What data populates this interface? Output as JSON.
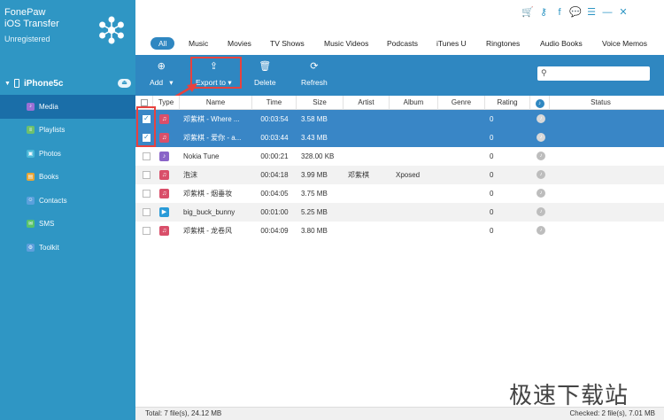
{
  "app": {
    "name_line1": "FonePaw",
    "name_line2": "iOS Transfer",
    "status": "Unregistered"
  },
  "top_icons": [
    "cart-icon",
    "key-icon",
    "facebook-icon",
    "feedback-icon",
    "menu-icon",
    "minimize-icon",
    "close-icon"
  ],
  "top_icon_glyphs": [
    "🛒",
    "⚷",
    "f",
    "💬",
    "☰",
    "—",
    "✕"
  ],
  "device": {
    "name": "iPhone5c",
    "eject_glyph": "⏏"
  },
  "sidebar": {
    "items": [
      {
        "label": "Media",
        "icon": "music-note-icon",
        "color": "#9b6fd4",
        "glyph": "♪",
        "active": true
      },
      {
        "label": "Playlists",
        "icon": "playlist-icon",
        "color": "#6dc06d",
        "glyph": "≡",
        "active": false
      },
      {
        "label": "Photos",
        "icon": "photo-icon",
        "color": "#4bb8d8",
        "glyph": "▣",
        "active": false
      },
      {
        "label": "Books",
        "icon": "book-icon",
        "color": "#e8a534",
        "glyph": "▤",
        "active": false
      },
      {
        "label": "Contacts",
        "icon": "contact-icon",
        "color": "#5aa0dc",
        "glyph": "☺",
        "active": false
      },
      {
        "label": "SMS",
        "icon": "message-icon",
        "color": "#59c36a",
        "glyph": "✉",
        "active": false
      },
      {
        "label": "Toolkit",
        "icon": "toolkit-icon",
        "color": "#5e9fdc",
        "glyph": "⚙",
        "active": false
      }
    ]
  },
  "filters": [
    "All",
    "Music",
    "Movies",
    "TV Shows",
    "Music Videos",
    "Podcasts",
    "iTunes U",
    "Ringtones",
    "Audio Books",
    "Voice Memos"
  ],
  "toolbar": {
    "add": {
      "label": "Add",
      "glyph": "⊕",
      "caret": "▾"
    },
    "export": {
      "label": "Export to",
      "glyph": "⇪",
      "caret": "▾"
    },
    "delete": {
      "label": "Delete",
      "glyph": "🗑"
    },
    "refresh": {
      "label": "Refresh",
      "glyph": "⟳"
    },
    "search_glyph": "⚲"
  },
  "table": {
    "headers": [
      "Type",
      "Name",
      "Time",
      "Size",
      "Artist",
      "Album",
      "Genre",
      "Rating",
      "Status"
    ],
    "rows": [
      {
        "checked": true,
        "selected": true,
        "type": "music",
        "type_color": "#d94f6a",
        "type_glyph": "♫",
        "name": "邓紫棋 - Where ...",
        "time": "00:03:54",
        "size": "3.58 MB",
        "artist": "",
        "album": "",
        "genre": "",
        "rating": "0"
      },
      {
        "checked": true,
        "selected": true,
        "type": "music",
        "type_color": "#d94f6a",
        "type_glyph": "♫",
        "name": "邓紫棋 - 爱你 - a...",
        "time": "00:03:44",
        "size": "3.43 MB",
        "artist": "",
        "album": "",
        "genre": "",
        "rating": "0"
      },
      {
        "checked": false,
        "selected": false,
        "type": "ringtone",
        "type_color": "#8a64c8",
        "type_glyph": "♪",
        "name": "Nokia Tune",
        "time": "00:00:21",
        "size": "328.00 KB",
        "artist": "",
        "album": "",
        "genre": "",
        "rating": "0"
      },
      {
        "checked": false,
        "selected": false,
        "type": "music",
        "type_color": "#d94f6a",
        "type_glyph": "♫",
        "name": "泡沫",
        "time": "00:04:18",
        "size": "3.99 MB",
        "artist": "邓紫棋",
        "album": "Xposed",
        "genre": "",
        "rating": "0"
      },
      {
        "checked": false,
        "selected": false,
        "type": "music",
        "type_color": "#d94f6a",
        "type_glyph": "♫",
        "name": "邓紫棋 - 烟垂妆",
        "time": "00:04:05",
        "size": "3.75 MB",
        "artist": "",
        "album": "",
        "genre": "",
        "rating": "0"
      },
      {
        "checked": false,
        "selected": false,
        "type": "movie",
        "type_color": "#2a9bd8",
        "type_glyph": "▶",
        "name": "big_buck_bunny",
        "time": "00:01:00",
        "size": "5.25 MB",
        "artist": "",
        "album": "",
        "genre": "",
        "rating": "0"
      },
      {
        "checked": false,
        "selected": false,
        "type": "music",
        "type_color": "#d94f6a",
        "type_glyph": "♫",
        "name": "邓紫棋 - 龙卷风",
        "time": "00:04:09",
        "size": "3.80 MB",
        "artist": "",
        "album": "",
        "genre": "",
        "rating": "0"
      }
    ]
  },
  "status_bar": {
    "total": "Total: 7 file(s), 24.12 MB",
    "checked": "Checked: 2 file(s), 7.01 MB"
  },
  "watermark": "极速下载站",
  "colors": {
    "sidebar": "#2f96c4",
    "accent": "#2f87c1",
    "highlight_box": "#e8423e"
  }
}
